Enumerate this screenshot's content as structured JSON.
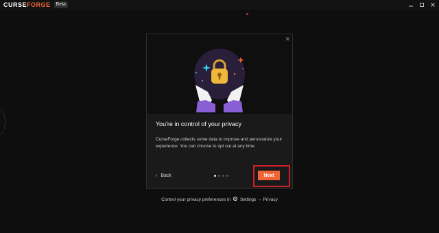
{
  "app": {
    "logo_curse": "CURSE",
    "logo_forge": "FORGE",
    "badge": "Beta"
  },
  "window_controls": [
    "minimize-icon",
    "maximize-icon",
    "close-icon"
  ],
  "modal": {
    "title": "You're in control of your privacy",
    "body": "CurseForge collects some data to improve and personalize your experience. You can choose to opt out at any time.",
    "back_label": "Back",
    "next_label": "Next",
    "steps": {
      "total": 4,
      "current": 1
    }
  },
  "footer": {
    "prefix": "Control your privacy preferences in",
    "path": "Settings → Privacy",
    "icon": "gear-icon"
  },
  "colors": {
    "accent": "#f16436",
    "background": "#0e0e0f",
    "modal": "#1a1a1b",
    "highlight": "#d0202a"
  }
}
